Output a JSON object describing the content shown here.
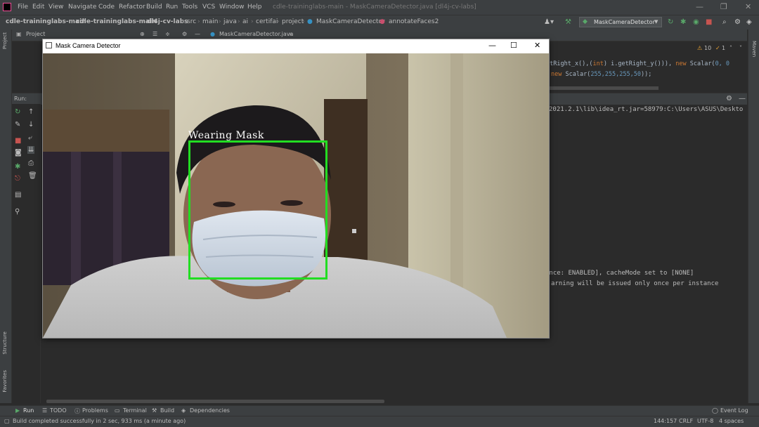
{
  "menubar": {
    "items": [
      "File",
      "Edit",
      "View",
      "Navigate",
      "Code",
      "Refactor",
      "Build",
      "Run",
      "Tools",
      "VCS",
      "Window",
      "Help"
    ],
    "title": "cdle-traininglabs-main - MaskCameraDetector.java [dl4j-cv-labs]"
  },
  "navbar": {
    "crumbs": [
      "cdle-traininglabs-main",
      "cdle-traininglabs-main",
      "dl4j-cv-labs",
      "src",
      "main",
      "java",
      "ai",
      "certifai",
      "project",
      "MaskCameraDetector",
      "annotateFaces2"
    ],
    "run_config": "MaskCameraDetector"
  },
  "tabs": {
    "project_label": "Project",
    "file_tab": "MaskCameraDetector.java"
  },
  "editor": {
    "warnings": "10",
    "errors": "1",
    "line1_a": "otRight_x(),(",
    "line1_kw": "int",
    "line1_b": ") i.getRight_y())), ",
    "line1_kw2": "new",
    "line1_c": " Scalar(",
    "line1_n": "0, 0",
    "line2_kw": "new",
    "line2_a": " Scalar(",
    "line2_n": "255,255,255,50",
    "line2_b": "));"
  },
  "run_panel": {
    "label": "Run:",
    "console_lines": [
      "2021.2.1\\lib\\idea_rt.jar=58979:C:\\Users\\ASUS\\Deskto",
      "ence: ENABLED], cacheMode set to [NONE]",
      "arning will be issued only once per instance"
    ]
  },
  "left_tools": {
    "project": "Project",
    "structure": "Structure",
    "favorites": "Favorites"
  },
  "right_tools": {
    "maven": "Maven"
  },
  "camera_window": {
    "title": "Mask Camera Detector",
    "label": "Wearing Mask",
    "box_color": "#22dd22"
  },
  "bottom_tools": [
    "Run",
    "TODO",
    "Problems",
    "Terminal",
    "Build",
    "Dependencies"
  ],
  "event_log": "Event Log",
  "status": {
    "message": "Build completed successfully in 2 sec, 933 ms (a minute ago)",
    "position": "144:157",
    "line_sep": "CRLF",
    "encoding": "UTF-8",
    "indent": "4 spaces"
  }
}
